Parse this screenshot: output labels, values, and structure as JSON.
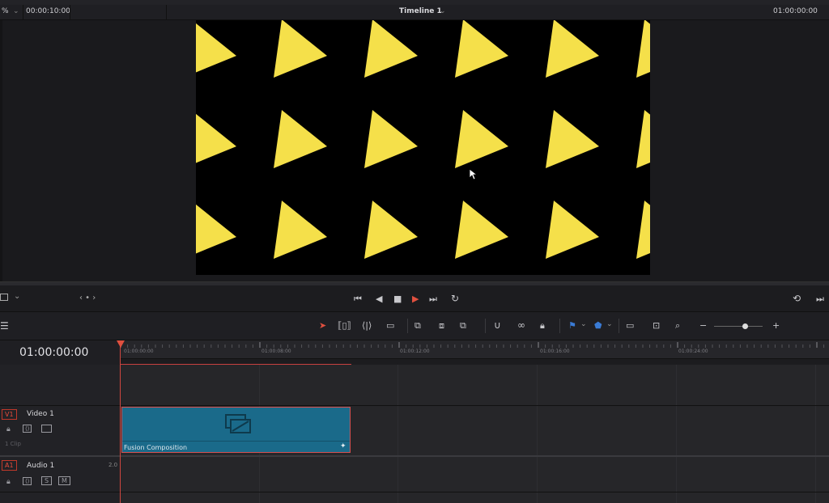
{
  "viewer": {
    "zoom": "%",
    "source_timecode": "00:00:10:00",
    "timeline_name": "Timeline 1",
    "record_timecode": "01:00:00:00"
  },
  "transport": {
    "nav_dots": "‹ • ›"
  },
  "timeline": {
    "current_timecode": "01:00:00:00",
    "ruler_labels": [
      "01:00:00:00",
      "01:00:08:00",
      "01:00:12:00",
      "01:00:16:00",
      "01:00:24:00"
    ]
  },
  "tracks": {
    "video": {
      "id": "V1",
      "name": "Video 1",
      "clip_count": "1 Clip"
    },
    "audio": {
      "id": "A1",
      "name": "Audio 1",
      "channels": "2.0",
      "solo": "S",
      "mute": "M"
    }
  },
  "clip": {
    "label": "Fusion Composition"
  },
  "colors": {
    "accent": "#e0503f",
    "clip": "#1a6a8a",
    "triangle": "#f5e04a"
  }
}
